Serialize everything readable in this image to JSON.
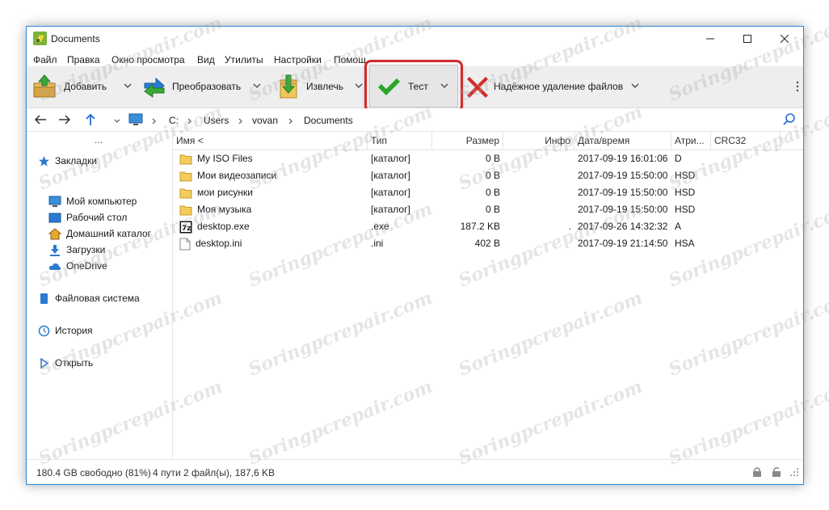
{
  "window": {
    "title": "Documents"
  },
  "menu": [
    "Файл",
    "Правка",
    "Окно просмотра",
    "Вид",
    "Утилиты",
    "Настройки",
    "Помощ"
  ],
  "toolbar": {
    "add": "Добавить",
    "convert": "Преобразовать",
    "extract": "Извлечь",
    "test": "Тест",
    "wipe": "Надёжное удаление файлов"
  },
  "address": {
    "crumbs": [
      "C:",
      "Users",
      "vovan",
      "Documents"
    ]
  },
  "sidebar": {
    "dots": "...",
    "bookmarks": "Закладки",
    "items": [
      "Мой компьютер",
      "Рабочий стол",
      "Домашний каталог",
      "Загрузки",
      "OneDrive"
    ],
    "filesystem": "Файловая система",
    "history": "История",
    "open": "Открыть"
  },
  "columns": [
    "Имя <",
    "Тип",
    "Размер",
    "Инфо",
    "Дата/время",
    "Атри...",
    "CRC32"
  ],
  "files": [
    {
      "name": "My ISO Files",
      "type": "[каталог]",
      "size": "0 B",
      "info": "",
      "date": "2017-09-19 16:01:06",
      "attr": "D",
      "icon": "folder-icon"
    },
    {
      "name": "Мои видеозаписи",
      "type": "[каталог]",
      "size": "0 B",
      "info": "",
      "date": "2017-09-19 15:50:00",
      "attr": "HSD",
      "icon": "folder-icon"
    },
    {
      "name": "мои рисунки",
      "type": "[каталог]",
      "size": "0 B",
      "info": "",
      "date": "2017-09-19 15:50:00",
      "attr": "HSD",
      "icon": "folder-icon"
    },
    {
      "name": "Моя музыка",
      "type": "[каталог]",
      "size": "0 B",
      "info": "",
      "date": "2017-09-19 15:50:00",
      "attr": "HSD",
      "icon": "folder-icon"
    },
    {
      "name": "desktop.exe",
      "type": ".exe",
      "size": "187.2 KB",
      "info": ".",
      "date": "2017-09-26 14:32:32",
      "attr": "A",
      "icon": "7z-exe-icon"
    },
    {
      "name": "desktop.ini",
      "type": ".ini",
      "size": "402 B",
      "info": "",
      "date": "2017-09-19 21:14:50",
      "attr": "HSA",
      "icon": "document-icon"
    }
  ],
  "status": {
    "free": "180.4 GB свободно (81%)",
    "summary": "4 пути 2 файл(ы), 187,6 KB"
  },
  "watermark": "Soringpcrepair.com",
  "colors": {
    "accent": "#2b8ad8",
    "highlight": "#d42a2a",
    "check": "#2aa52a",
    "delete": "#d42a2a"
  }
}
